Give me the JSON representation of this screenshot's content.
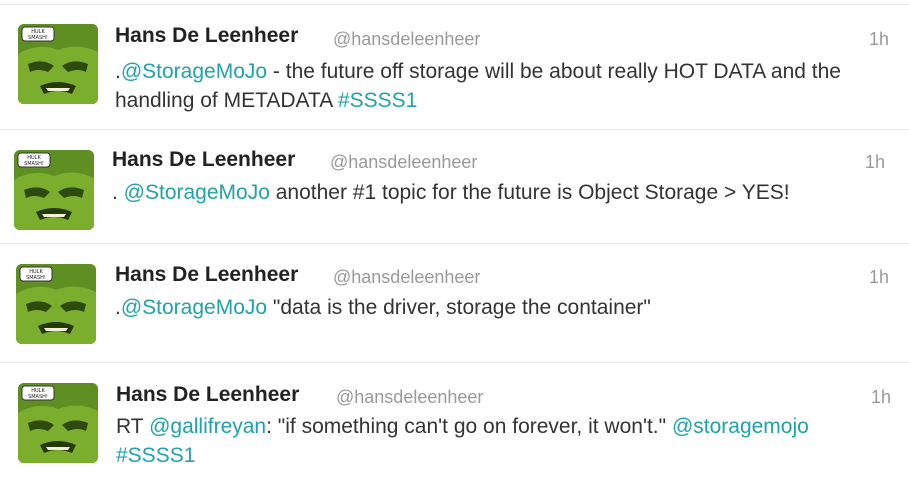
{
  "tweets": [
    {
      "name": "Hans De Leenheer",
      "handle": "@hansdeleenheer",
      "time": "1h",
      "parts": {
        "p1": ".",
        "m1": "@StorageMoJo",
        "p2": " - the future off storage will be about really HOT DATA and the handling of METADATA ",
        "h1": "#SSSS1"
      }
    },
    {
      "name": "Hans De Leenheer",
      "handle": "@hansdeleenheer",
      "time": "1h",
      "parts": {
        "p1": ". ",
        "m1": "@StorageMoJo",
        "p2": " another #1 topic for the future is Object Storage > YES!"
      }
    },
    {
      "name": "Hans De Leenheer",
      "handle": "@hansdeleenheer",
      "time": "1h",
      "parts": {
        "p1": ".",
        "m1": "@StorageMoJo",
        "p2": " \"data is the driver, storage the container\""
      }
    },
    {
      "name": "Hans De Leenheer",
      "handle": "@hansdeleenheer",
      "time": "1h",
      "parts": {
        "p1": "RT ",
        "m1": "@gallifreyan",
        "p2": ": \"if something can't go on forever, it won't.\" ",
        "m2": "@storagemojo",
        "h1": "#SSSS1"
      }
    }
  ],
  "avatar": {
    "speech_bubble_text": "HULK SMASH!",
    "icon": "hulk-avatar-icon"
  },
  "colors": {
    "link": "#1fa3a8",
    "name": "#222222",
    "meta": "#999999",
    "divider": "#e8e8e8"
  }
}
